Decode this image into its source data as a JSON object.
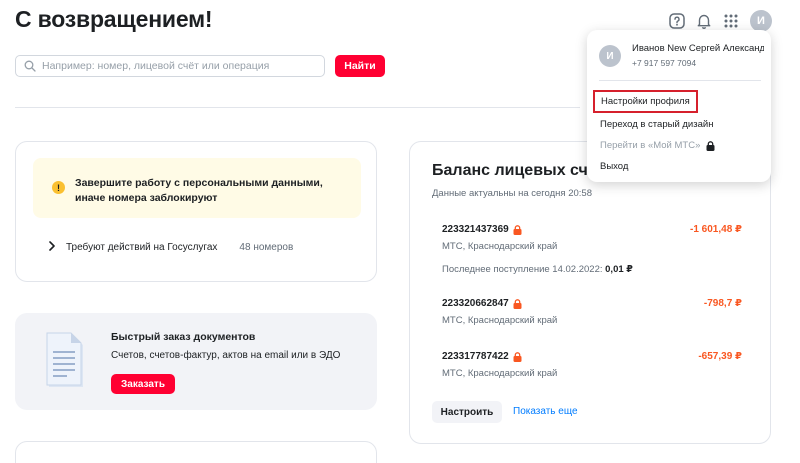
{
  "page": {
    "title": "С возвращением!"
  },
  "header": {
    "icons": [
      "help-icon",
      "bell-icon",
      "apps-grid-icon"
    ],
    "avatar_initial": "И"
  },
  "search": {
    "placeholder": "Например: номер, лицевой счёт или операция",
    "value": "",
    "button_label": "Найти"
  },
  "personal_data_card": {
    "warning_text": "Завершите работу с персональными данными, иначе номера заблокируют",
    "warning_icon_glyph": "!",
    "gosuslugi_label": "Требуют действий на Госуслугах",
    "gosuslugi_count": "48 номеров"
  },
  "documents_card": {
    "title": "Быстрый заказ документов",
    "subtitle": "Счетов, счетов-фактур, актов на email или в ЭДО",
    "button_label": "Заказать"
  },
  "balance_card": {
    "title": "Баланс лицевых сче",
    "subtitle": "Данные актуальны на сегодня 20:58",
    "accounts": [
      {
        "number": "223321437369",
        "region": "МТС, Краснодарский край",
        "amount": "-1 601,48 ₽",
        "last_payment_label": "Последнее поступление 14.02.2022:",
        "last_payment_value": "0,01 ₽"
      },
      {
        "number": "223320662847",
        "region": "МТС, Краснодарский край",
        "amount": "-798,7 ₽"
      },
      {
        "number": "223317787422",
        "region": "МТС, Краснодарский край",
        "amount": "-657,39 ₽"
      }
    ],
    "setup_label": "Настроить",
    "more_label": "Показать еще"
  },
  "profile_menu": {
    "avatar_initial": "И",
    "name": "Иванов New Сергей Александрович",
    "phone": "+7 917 597 7094",
    "items": [
      {
        "label": "Настройки профиля",
        "highlighted": true
      },
      {
        "label": "Переход в старый дизайн"
      },
      {
        "label": "Перейти в «Мой МТС»",
        "disabled": true
      },
      {
        "label": "Выход"
      }
    ]
  },
  "colors": {
    "brand_red": "#ff0032",
    "negative_amount": "#f95721",
    "link": "#007cff",
    "warning_bg": "#fffbe6",
    "highlight_border": "#d6202c"
  }
}
